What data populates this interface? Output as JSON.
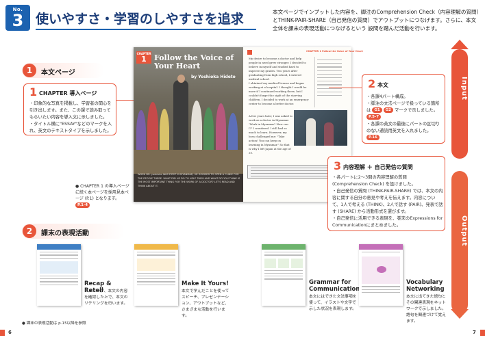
{
  "header": {
    "badge_label": "No.",
    "badge_number": "3",
    "title": "使いやすさ・学習のしやすさを追求",
    "description": "本文ページでインプットした内容を、脚注のComprehension Check（内容理解の質問）とTHINK-PAIR-SHARE（自己発信の質問）でアウトプットにつなげます。さらに、本文全体を課末の表現活動につなげるという 設問を踏んだ活動を行います。"
  },
  "bands": {
    "input": "Input",
    "output": "Output"
  },
  "section1": {
    "number": "1",
    "label": "本文ページ"
  },
  "section2": {
    "number": "2",
    "label": "課末の表現活動"
  },
  "callout_chapter": {
    "number": "1",
    "title": "CHAPTER 導入ページ",
    "body_1": "・印象的な写真を掲載し、学習者の関心を引き出します。また、この課で読み取ってもらいたい内容を導入文に示しました。",
    "body_2": "・タイトル横に\"ESSAY\"などのマークを入れ、英文のテキストタイプを示しました。"
  },
  "chapter_note": {
    "text": "● CHAPTER 1 の導入ページに続く本ページを採用見本ページ (P.1) となります。",
    "pill": "P.1-4"
  },
  "callout_body": {
    "number": "2",
    "title": "本文",
    "line_1": "・各課4パート構成。",
    "line_2": "・脚注の文法ページで扱っている箇所は",
    "pill_a": "G1",
    "pill_b": "G2",
    "line_2b": "マークで示しました。",
    "pill_c": "P.5-7",
    "line_3": "・各課の英文の最後にパートの区切りのない通読用英文を入れました。",
    "pill_d": "P.16"
  },
  "callout_questions": {
    "number": "3",
    "title": "内容理解 ＋ 自己発信の質問",
    "line_1": "・各パートに2〜3問の内容理解の質問 (Comprehension Check) を設けました。",
    "line_2": "・自己発信の質問 (THINK-PAIR-SHARE) では、本文の内容に関する自分の意見や考えを伝えます。内容について、1人で考える (THINK)、2人で話す (PAIR)、発表で話す (SHARE) から活動形式を選びます。",
    "line_3": "・自己発信に活用できる表現を、巻末のExpressions for Communicationにまとめました。"
  },
  "book": {
    "chapter_word": "CHAPTER",
    "chapter_num": "1",
    "chapter_title": "Follow the Voice of Your Heart",
    "author": "by Yoshioka Hideto",
    "caption": "WHEN DR. yoshioka WAS FIRST IN MYANMAR, HE DECIDED TO OPEN A CLINIC FOR THE PEOPLE THERE. WHAT DID HE DO TO HELP THEM AND WHAT DO YOU THINK IS THE MOST IMPORTANT THING FOR THE WORK OF A DOCTOR? LET'S READ AND THINK ABOUT IT.",
    "right_header": "CHAPTER 1  Follow the Voice of Your Heart",
    "right_para_1": "My desire to become a doctor and help people in need grew stronger. I decided to believe in myself and studied hard to improve my grades. Two years after graduating from high school, I entered medical school.",
    "right_para_2": "I obtained my medical license and began working at a hospital. I thought I would be more if I continued working there, but I couldn't forget the sight of the starving children. I decided to work at an emergency center to become a better doctor.",
    "right_para_3": "A few years later, I was asked to work as a doctor in Myanmar. \"Work in Myanmar? How can I?\" I wondered. I still had so much to learn. However, my boss challenged me: \"Take action! You can keep on learning in Myanmar.\" So that is why I left Japan at the age of 39."
  },
  "activities": [
    {
      "title": "Recap & Retell",
      "body": "リスニング、本文の内容を確認した上で、本文のリテリングを行います。"
    },
    {
      "title": "Make It Yours!",
      "body": "本文で学んだことを使ってスピーチ、プレゼンテーション、アウトプットなど、さまざまな活動を行います。"
    },
    {
      "title": "Grammar for Communication",
      "body": "本文にはできた文法事項を使って、イラストや文字で示した状況を表現します。"
    },
    {
      "title": "Vocabulary Networking",
      "body": "本文に出てきた語句とその関連表現をネットワークで示しました。語句を関連づけて覚えます。"
    }
  ],
  "thumbs": [
    {
      "title": "Recap & Retell"
    },
    {
      "title": "Make It Yours!"
    },
    {
      "title": "Grammar for Communication"
    },
    {
      "title": "Vocabulary Networking"
    }
  ],
  "footnote": "● 課末の表現活動は p.15以降を参照",
  "page_left": "6",
  "page_right": "7",
  "colors": {
    "accent": "#e8553a",
    "blue": "#1c62b0"
  }
}
